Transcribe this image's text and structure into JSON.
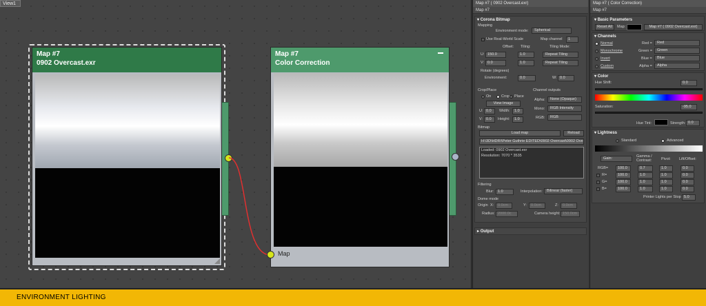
{
  "viewport": {
    "tab": "View1"
  },
  "node1": {
    "title": "Map #7",
    "subtitle": "0902 Overcast.exr"
  },
  "node2": {
    "title": "Map #7",
    "subtitle": "Color Correction",
    "input_label": "Map"
  },
  "bottom": {
    "label": "ENVIRONMENT LIGHTING"
  },
  "corona_panel": {
    "title": "Map #7 ( 0902 Overcast.exr)",
    "name": "Map #7",
    "section": "Corona Bitmap",
    "mapping": "Mapping",
    "env_mode_label": "Environment mode:",
    "env_mode_value": "Spherical",
    "use_real_world": "Use Real-World Scale",
    "map_channel_label": "Map channel",
    "map_channel_value": "1",
    "offset": "Offset:",
    "tiling": "Tiling:",
    "tiling_mode": "Tiling Mode:",
    "u_label": "U:",
    "u_offset": "150.0",
    "u_tiling": "1.0",
    "u_mode": "Repeat Tiling",
    "v_label": "V:",
    "v_offset": "0.0",
    "v_tiling": "1.0",
    "v_mode": "Repeat Tiling",
    "rotate": "Rotate (degrees)",
    "env_label": "Environment:",
    "env_value": "0.0",
    "w_label": "W:",
    "w_value": "0.0",
    "crop_place": "Crop/Place",
    "on": "On",
    "crop": "Crop",
    "place": "Place",
    "view_image": "View Image",
    "cu_label": "U:",
    "cu": "0.0",
    "width_label": "Width:",
    "width": "1.0",
    "cv_label": "V:",
    "cv": "0.0",
    "height_label": "Height:",
    "height": "1.0",
    "channel_outputs": "Channel outputs",
    "alpha_label": "Alpha:",
    "alpha_value": "None (Opaque)",
    "mono_label": "Mono:",
    "mono_value": "RGB Intensity",
    "rgb_label": "RGB:",
    "rgb_value": "RGB",
    "bitmap": "Bitmap",
    "load_map": "Load map",
    "reload": "Reload",
    "path": "H:\\3D\\HDRI\\Peter Guthrie EDITED\\0902 Overcast\\0902 Overca",
    "loaded": "Loaded: 0902 Overcast.exr",
    "resolution": "Resolution: 7070 * 3535",
    "filtering": "Filtering",
    "blur_label": "Blur:",
    "blur": "1.0",
    "interp_label": "Interpolation:",
    "interp": "Bilinear (faster)",
    "dome_mode": "Dome mode",
    "origin": "Origin",
    "x": "X:",
    "x_value": "0.0cm",
    "y": "Y:",
    "y_value": "0.0cm",
    "z": "Z:",
    "z_value": "0.0cm",
    "radius_label": "Radius:",
    "radius": "2000.0c",
    "cam_h_label": "Camera height:",
    "cam_h": "150.0cm",
    "output": "Output"
  },
  "cc_panel": {
    "title": "Map #7 ( Color Correction)",
    "name": "Map #7",
    "basic": "Basic Parameters",
    "reset_all": "Reset All",
    "map_label": "Map:",
    "map_value": "Map #7 ( 0902 Overcast.exr)",
    "channels": "Channels",
    "normal": "Normal",
    "monochrome": "Monochrome",
    "invert": "Invert",
    "custom": "Custom",
    "red_label": "Red =",
    "red_value": "Red",
    "green_label": "Green =",
    "green_value": "Green",
    "blue_label": "Blue =",
    "blue_value": "Blue",
    "alpha_label": "Alpha =",
    "alpha_value": "Alpha",
    "color": "Color",
    "hue_shift_label": "Hue Shift:",
    "hue_shift": "0.0",
    "saturation_label": "Saturation:",
    "saturation": "-95.0",
    "hue_tint_label": "Hue Tint:",
    "strength_label": "Strength:",
    "strength": "0.0",
    "lightness": "Lightness",
    "standard": "Standard",
    "advanced": "Advanced",
    "gain_mode": "Gain:",
    "gamma_label": "Gamma / Contrast:",
    "pivot_label": "Pivot:",
    "lift_label": "Lift/Offset:",
    "rows": [
      {
        "label": "RGB=",
        "gain": "100.0",
        "gamma": "0.7",
        "pivot": "1.0",
        "lift": "0.0"
      },
      {
        "label": "R=",
        "gain": "100.0",
        "gamma": "1.0",
        "pivot": "1.0",
        "lift": "0.0"
      },
      {
        "label": "G=",
        "gain": "100.0",
        "gamma": "1.0",
        "pivot": "1.0",
        "lift": "0.0"
      },
      {
        "label": "B=",
        "gain": "100.0",
        "gamma": "1.0",
        "pivot": "1.0",
        "lift": "0.0"
      }
    ],
    "printer_label": "Printer Lights per Stop",
    "printer": "5.0"
  },
  "colors": {
    "node_green": "#2f7a48",
    "node_teal": "#4e9a6c",
    "port_yellow": "#d6e51a",
    "wire": "#e03030",
    "status": "#f2b705"
  }
}
